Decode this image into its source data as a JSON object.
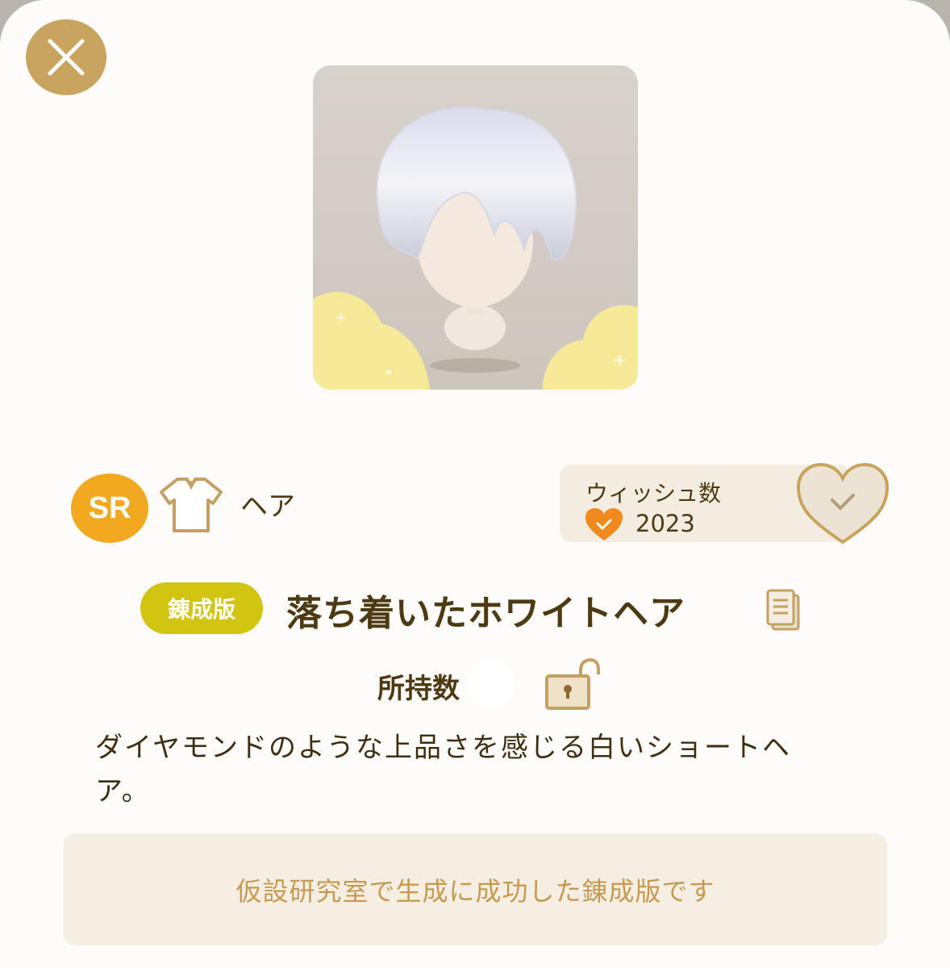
{
  "header": {
    "close_icon": "close-icon"
  },
  "item": {
    "image": "white-short-hair-on-mannequin",
    "rarity": "SR",
    "category_icon": "shirt-icon",
    "category": "ヘア",
    "version_badge": "錬成版",
    "name": "落ち着いたホワイトヘア",
    "owned_label": "所持数",
    "lock_icon": "unlocked-lock-icon",
    "description": "ダイヤモンドのような上品さを感じる白いショートヘア。",
    "note": "仮設研究室で生成に成功した錬成版です"
  },
  "wish": {
    "label": "ウィッシュ数",
    "count": "2023",
    "button_icon": "heart-check-icon"
  },
  "colors": {
    "accent_gold": "#c9a45e",
    "rarity_orange": "#f2a81f",
    "badge_yellow": "#d2c512",
    "text_brown": "#4e3a12"
  }
}
